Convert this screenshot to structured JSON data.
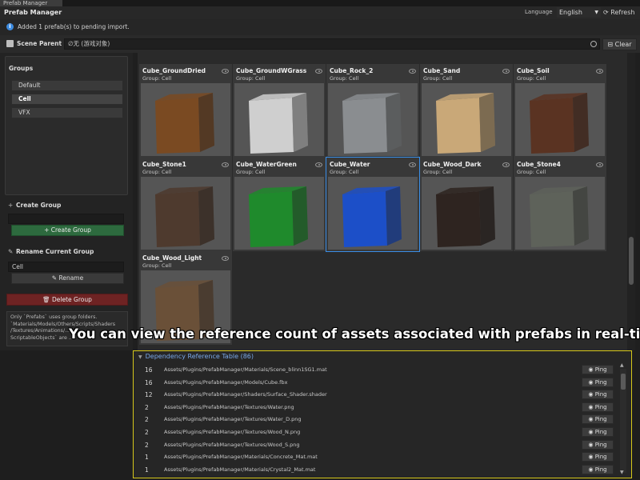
{
  "window": {
    "tab_title": "Prefab Manager",
    "title": "Prefab Manager"
  },
  "header": {
    "language_label": "Language",
    "language_value": "English",
    "refresh_label": "Refresh"
  },
  "info": {
    "message": "Added 1 prefab(s) to pending import."
  },
  "scene_parent": {
    "label": "Scene Parent",
    "value": "∅无 (游戏对象)",
    "clear_label": "Clear"
  },
  "groups": {
    "title": "Groups",
    "items": [
      {
        "label": "Default"
      },
      {
        "label": "Cell",
        "selected": true
      },
      {
        "label": "VFX"
      }
    ]
  },
  "create_group": {
    "title": "Create Group",
    "value": "",
    "button_label": "Create Group"
  },
  "rename_group": {
    "title": "Rename Current Group",
    "value": "Cell",
    "button_label": "Rename"
  },
  "delete_group": {
    "button_label": "Delete Group"
  },
  "note": {
    "lines": [
      "Only `Prefabs` uses group folders.",
      "`Materials/Models/Others/Scripts/Shaders",
      "/Textures/Animations/...",
      "ScriptableObjects` are ..."
    ]
  },
  "prefabs": [
    {
      "name": "Cube_GroundDried",
      "group": "Group: Cell",
      "color": "#7a4a22"
    },
    {
      "name": "Cube_GroundWGrass",
      "group": "Group: Cell",
      "color": "#cfcfcf"
    },
    {
      "name": "Cube_Rock_2",
      "group": "Group: Cell",
      "color": "#8a8d90"
    },
    {
      "name": "Cube_Sand",
      "group": "Group: Cell",
      "color": "#c9a878"
    },
    {
      "name": "Cube_Soil",
      "group": "Group: Cell",
      "color": "#5a3322"
    },
    {
      "name": "Cube_Stone1",
      "group": "Group: Cell",
      "color": "#4e3a2e"
    },
    {
      "name": "Cube_WaterGreen",
      "group": "Group: Cell",
      "color": "#1f8a2c"
    },
    {
      "name": "Cube_Water",
      "group": "Group: Cell",
      "color": "#1c4fc8",
      "selected": true
    },
    {
      "name": "Cube_Wood_Dark",
      "group": "Group: Cell",
      "color": "#2e2420"
    },
    {
      "name": "Cube_Stone4",
      "group": "Group: Cell",
      "color": "#5e625a"
    },
    {
      "name": "Cube_Wood_Light",
      "group": "Group: Cell",
      "color": "#6a5038"
    }
  ],
  "caption": "You can view the reference count of assets associated with prefabs in real-time.",
  "dependency": {
    "header": "Dependency Reference Table (86)",
    "ping_label": "Ping",
    "rows": [
      {
        "count": "16",
        "path": "Assets/Plugins/PrefabManager/Materials/Scene_blinn1SG1.mat"
      },
      {
        "count": "16",
        "path": "Assets/Plugins/PrefabManager/Models/Cube.fbx"
      },
      {
        "count": "12",
        "path": "Assets/Plugins/PrefabManager/Shaders/Surface_Shader.shader"
      },
      {
        "count": "2",
        "path": "Assets/Plugins/PrefabManager/Textures/Water.png"
      },
      {
        "count": "2",
        "path": "Assets/Plugins/PrefabManager/Textures/Water_D.png"
      },
      {
        "count": "2",
        "path": "Assets/Plugins/PrefabManager/Textures/Wood_N.png"
      },
      {
        "count": "2",
        "path": "Assets/Plugins/PrefabManager/Textures/Wood_S.png"
      },
      {
        "count": "1",
        "path": "Assets/Plugins/PrefabManager/Materials/Concrete_Mat.mat"
      },
      {
        "count": "1",
        "path": "Assets/Plugins/PrefabManager/Materials/Crystal2_Mat.mat"
      }
    ]
  },
  "colors": {
    "accent_blue": "#3a8ee6",
    "highlight_yellow": "#d6c81a",
    "create_green": "#2d6a3e",
    "delete_red": "#6e2323"
  }
}
